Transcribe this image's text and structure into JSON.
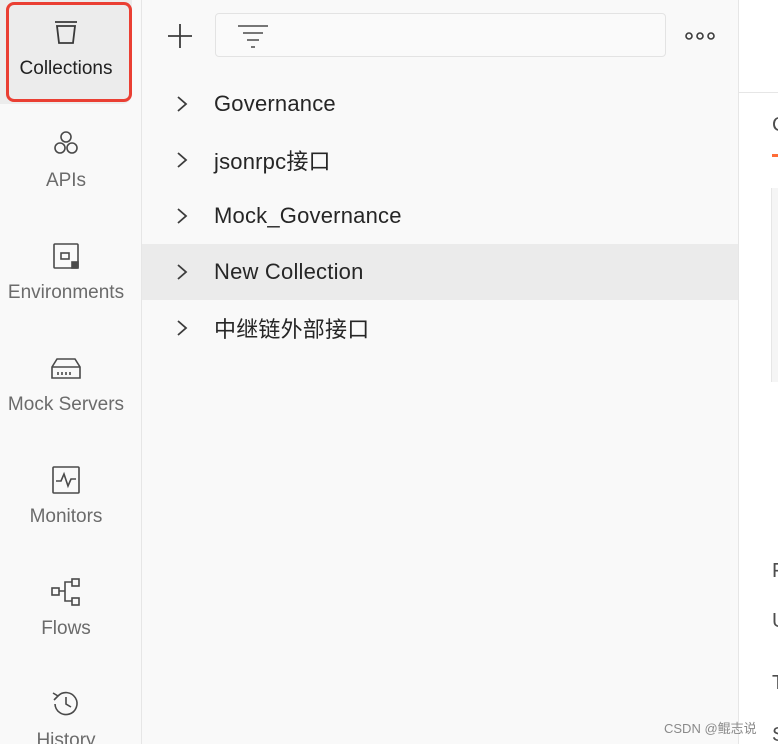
{
  "sidebar": {
    "items": [
      {
        "label": "Collections",
        "icon": "trash-can-icon"
      },
      {
        "label": "APIs",
        "icon": "hexagons-icon"
      },
      {
        "label": "Environments",
        "icon": "environment-icon"
      },
      {
        "label": "Mock Servers",
        "icon": "server-icon"
      },
      {
        "label": "Monitors",
        "icon": "pulse-monitor-icon"
      },
      {
        "label": "Flows",
        "icon": "flow-icon"
      },
      {
        "label": "History",
        "icon": "history-icon"
      }
    ],
    "active": "Collections"
  },
  "toolbar": {
    "add_icon": "plus-icon",
    "filter_icon": "filter-icon",
    "more_icon": "ellipsis-icon",
    "filter_value": ""
  },
  "collections": [
    {
      "name": "Governance"
    },
    {
      "name": "jsonrpc接口"
    },
    {
      "name": "Mock_Governance"
    },
    {
      "name": "New Collection",
      "highlighted": true
    },
    {
      "name": "中继链外部接口"
    }
  ],
  "right_pane": {
    "fragments": [
      "C",
      "F",
      "U",
      "T",
      "S"
    ]
  },
  "watermark": "CSDN @鲲志说",
  "colors": {
    "accent": "#ff6c37",
    "active_outline": "#ea3f33",
    "panel_bg": "#f9f9f9",
    "row_highlight": "#ebebeb"
  }
}
